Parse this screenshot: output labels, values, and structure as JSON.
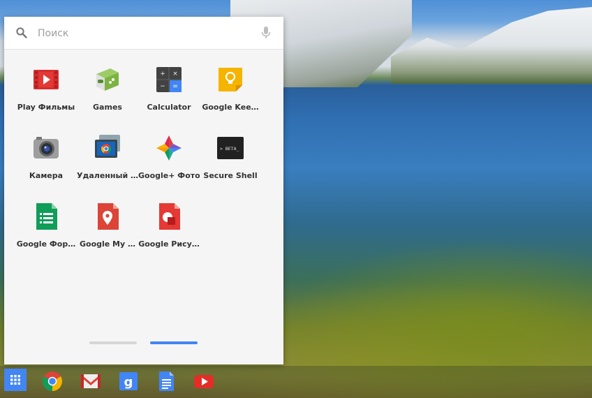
{
  "search": {
    "placeholder": "Поиск"
  },
  "apps": [
    {
      "label": "Play Фильмы",
      "icon": "play-movies-icon"
    },
    {
      "label": "Games",
      "icon": "games-icon"
    },
    {
      "label": "Calculator",
      "icon": "calculator-icon"
    },
    {
      "label": "Google Kee…",
      "icon": "google-keep-icon"
    },
    {
      "label": "Камера",
      "icon": "camera-icon"
    },
    {
      "label": "Удаленный …",
      "icon": "remote-desktop-icon"
    },
    {
      "label": "Google+ Фото",
      "icon": "google-photos-icon"
    },
    {
      "label": "Secure Shell",
      "icon": "secure-shell-icon",
      "icon_text": "> BETA_"
    },
    {
      "label": "Google Фор…",
      "icon": "google-forms-icon"
    },
    {
      "label": "Google My …",
      "icon": "google-my-maps-icon"
    },
    {
      "label": "Google Рису…",
      "icon": "google-drawings-icon"
    }
  ],
  "calculator_keys": [
    "+",
    "×",
    "−",
    "="
  ],
  "pages": {
    "count": 2,
    "active": 2
  },
  "shelf": [
    {
      "icon": "app-launcher-icon"
    },
    {
      "icon": "chrome-icon"
    },
    {
      "icon": "gmail-icon"
    },
    {
      "icon": "google-search-icon",
      "text": "g"
    },
    {
      "icon": "google-docs-icon"
    },
    {
      "icon": "youtube-icon"
    }
  ],
  "colors": {
    "accent": "#4285f4",
    "pager_inactive": "#d6d6d6",
    "panel_bg": "#f5f5f5"
  }
}
